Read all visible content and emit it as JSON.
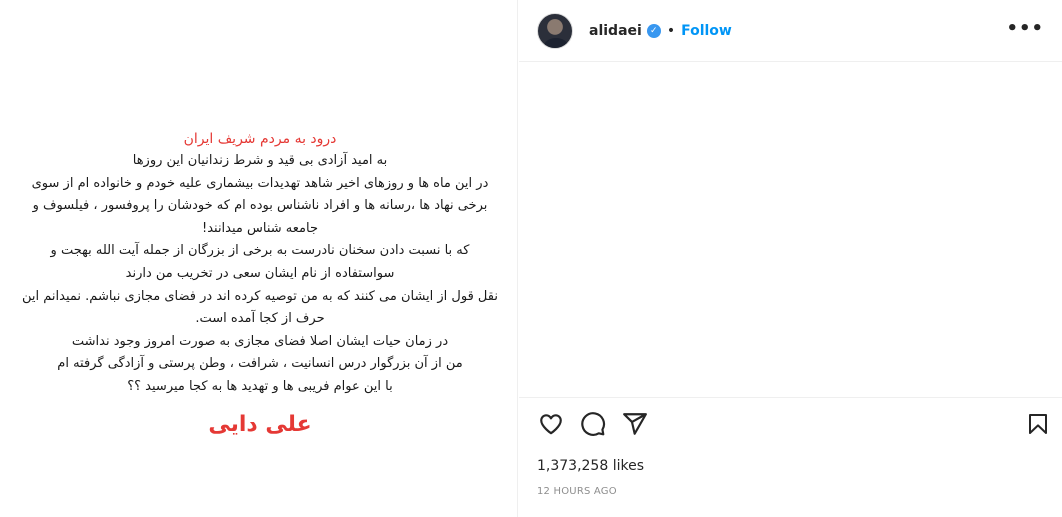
{
  "post": {
    "title": "درود به مردم شریف ایران",
    "lines": [
      "به امید آزادی بی قید و شرط زندانیان این روزها",
      "در این ماه ها و روزهای اخیر شاهد تهدیدات بیشماری علیه خودم و خانواده ام از سوی",
      "برخی نهاد ها ،رسانه ها و افراد ناشناس بوده ام که خودشان را پروفسور ، فیلسوف و",
      "جامعه شناس میدانند!",
      "که با نسبت دادن سخنان نادرست به برخی از بزرگان از جمله آیت الله بهجت و",
      "سواستفاده از نام ایشان سعی در تخریب من دارند",
      "نقل قول از ایشان می کنند که به من توصیه کرده اند در فضای مجازی نباشم. نمیدانم این",
      "حرف از کجا آمده است.",
      "در زمان حیات ایشان اصلا فضای مجازی به صورت امروز وجود نداشت",
      "من از آن بزرگوار درس انسانیت ، شرافت ، وطن پرستی و آزادگی گرفته ام",
      "با این عوام فریبی ها و تهدید ها به کجا میرسید ؟؟"
    ],
    "signature": "علی دایی"
  },
  "header": {
    "username": "alidaei",
    "separator": "•",
    "follow_label": "Follow",
    "more_label": "•••"
  },
  "icons": {
    "like": "heart-icon",
    "comment": "comment-icon",
    "share": "share-icon",
    "save": "bookmark-icon",
    "verified": "verified-badge-icon"
  },
  "stats": {
    "likes": "1,373,258 likes",
    "time": "12 HOURS AGO"
  },
  "colors": {
    "accent": "#0095f6",
    "verified": "#3897f0",
    "post_title": "#e53935"
  }
}
